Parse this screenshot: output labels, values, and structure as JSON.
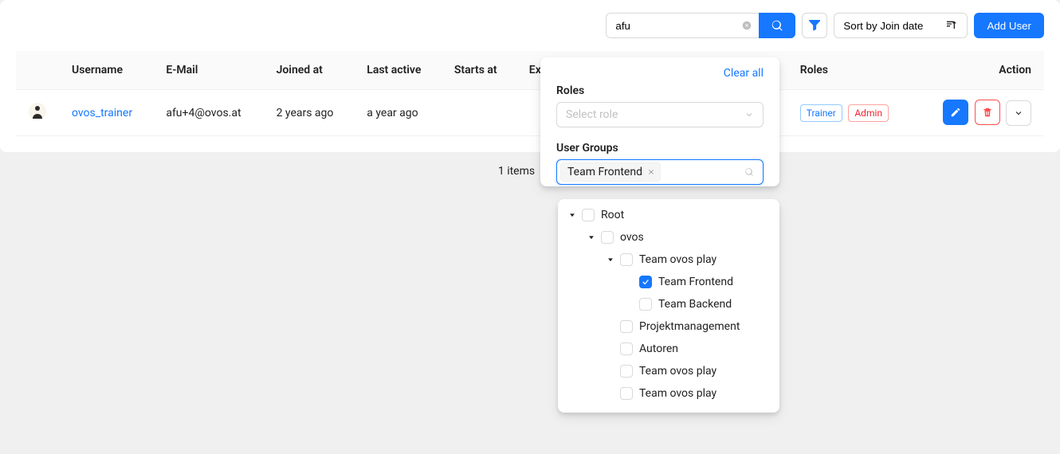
{
  "toolbar": {
    "search_value": "afu",
    "sort_label": "Sort by Join date",
    "add_user_label": "Add User"
  },
  "table": {
    "headers": {
      "username": "Username",
      "email": "E-Mail",
      "joined": "Joined at",
      "last_active": "Last active",
      "starts": "Starts at",
      "expires": "Expires at",
      "roles": "Roles",
      "action": "Action"
    },
    "rows": [
      {
        "username": "ovos_trainer",
        "email": "afu+4@ovos.at",
        "joined": "2 years ago",
        "last_active": "a year ago",
        "starts": "",
        "expires": "",
        "roles": [
          "Trainer",
          "Admin"
        ]
      }
    ]
  },
  "footer": {
    "count_label": "1 items"
  },
  "filter": {
    "clear_all_label": "Clear all",
    "roles_label": "Roles",
    "roles_placeholder": "Select role",
    "user_groups_label": "User Groups",
    "selected_group": "Team Frontend"
  },
  "tree": {
    "root_label": "Root",
    "ovos_label": "ovos",
    "team_ovos_play": "Team ovos play",
    "team_frontend": "Team Frontend",
    "team_backend": "Team Backend",
    "projektmanagement": "Projektmanagement",
    "autoren": "Autoren",
    "team_ovos_play2": "Team ovos play",
    "team_ovos_play3": "Team ovos play"
  }
}
